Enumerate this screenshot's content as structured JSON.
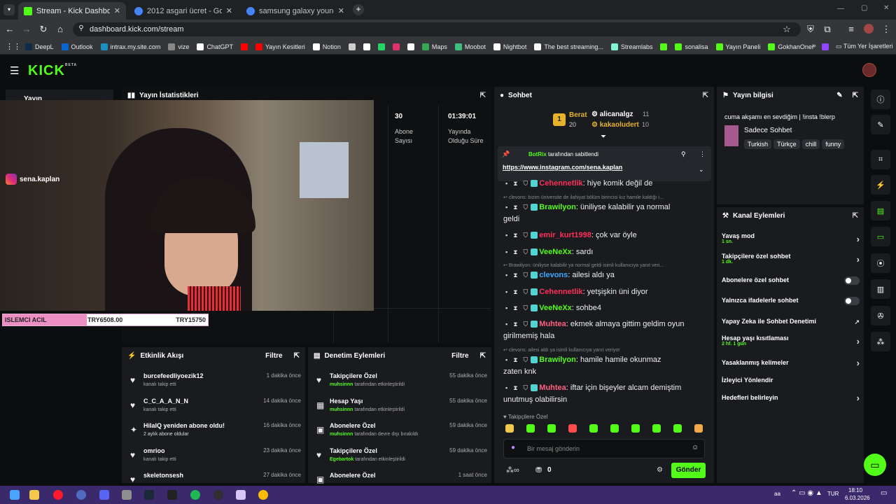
{
  "browser": {
    "tabs": [
      {
        "title": "Stream - Kick Dashboard",
        "color": "#53fc18"
      },
      {
        "title": "2012 asgari ücret - Google'da A",
        "color": "#4285f4"
      },
      {
        "title": "samsung galaxy young - Goog",
        "color": "#4285f4"
      }
    ],
    "url": "dashboard.kick.com/stream",
    "bookmarks": [
      {
        "label": "DeepL",
        "color": "#0f2b46"
      },
      {
        "label": "Outlook",
        "color": "#0a64d2"
      },
      {
        "label": "intrax.my.site.com",
        "color": "#1b8fbf"
      },
      {
        "label": "vize",
        "color": "#888888"
      },
      {
        "label": "ChatGPT",
        "color": "#ffffff"
      },
      {
        "label": "",
        "color": "#ff0000"
      },
      {
        "label": "Yayın Kesitleri",
        "color": "#ff0000"
      },
      {
        "label": "Notion",
        "color": "#ffffff"
      },
      {
        "label": "",
        "color": "#cccccc"
      },
      {
        "label": "",
        "color": "#ffffff"
      },
      {
        "label": "",
        "color": "#25d366"
      },
      {
        "label": "",
        "color": "#e1306c"
      },
      {
        "label": "",
        "color": "#ffffff"
      },
      {
        "label": "Maps",
        "color": "#34a853"
      },
      {
        "label": "Moobot",
        "color": "#3fbf7f"
      },
      {
        "label": "Nightbot",
        "color": "#ffffff"
      },
      {
        "label": "The best streaming...",
        "color": "#ffffff"
      },
      {
        "label": "Streamlabs",
        "color": "#80f5d2"
      },
      {
        "label": "",
        "color": "#53fc18"
      },
      {
        "label": "sonalisa",
        "color": "#53fc18"
      },
      {
        "label": "Yayın Paneli",
        "color": "#53fc18"
      },
      {
        "label": "GokhanOner",
        "color": "#53fc18"
      },
      {
        "label": "",
        "color": "#9146ff"
      }
    ],
    "all_bookmarks": "Tüm Yer İşaretleri"
  },
  "sidebar": {
    "item": "Yayın"
  },
  "stats": {
    "title": "Yayın İstatistikleri",
    "subscribers_value": "30",
    "subscribers_label": "Abone Sayısı",
    "uptime_value": "01:39:01",
    "uptime_label": "Yayında Olduğu Süre"
  },
  "overlay": {
    "instagram": "sena.kaplan",
    "goal_label": "ISLEMCI ACIL",
    "goal_current": "TRY6508.00",
    "goal_target": "TRY15750",
    "goal_progress": 0.413
  },
  "activity": {
    "title": "Etkinlik Akışı",
    "filter": "Filtre",
    "items": [
      {
        "name": "burcefeedliyoezik12",
        "sub": "kanalı takip etti",
        "time": "1 dakika önce",
        "icon": "♥"
      },
      {
        "name": "C_C_A_A_N_N",
        "sub": "kanalı takip etti",
        "time": "14 dakika önce",
        "icon": "♥"
      },
      {
        "name": "HilalQ yeniden abone oldu!",
        "sub": "2 aylık abone oldular",
        "time": "16 dakika önce",
        "icon": "✦"
      },
      {
        "name": "omrioo",
        "sub": "kanalı takip etti",
        "time": "23 dakika önce",
        "icon": "♥"
      },
      {
        "name": "skeletonsesh",
        "sub": "",
        "time": "27 dakika önce",
        "icon": "♥"
      }
    ]
  },
  "moderation": {
    "title": "Denetim Eylemleri",
    "filter": "Filtre",
    "items": [
      {
        "name": "Takipçilere Özel",
        "user": "muhsinnn",
        "sub": "tarafından etkinleştirildi",
        "time": "55 dakika önce",
        "icon": "♥"
      },
      {
        "name": "Hesap Yaşı",
        "user": "muhsinnn",
        "sub": "tarafından etkinleştirildi",
        "time": "55 dakika önce",
        "icon": "▦"
      },
      {
        "name": "Abonelere Özel",
        "user": "muhsinnn",
        "sub": "tarafından devre dışı bırakıldı",
        "time": "59 dakika önce",
        "icon": "▣"
      },
      {
        "name": "Takipçilere Özel",
        "user": "Egebartok",
        "sub": "tarafından etkinleştirildi",
        "time": "59 dakika önce",
        "icon": "♥"
      },
      {
        "name": "Abonelere Özel",
        "user": "",
        "sub": "",
        "time": "1 saat önce",
        "icon": "▣"
      }
    ]
  },
  "chat": {
    "title": "Sohbet",
    "leaders": [
      {
        "rank": "1",
        "name": "Berat",
        "count": "20"
      },
      {
        "name": "alicanalgz",
        "count": "11"
      },
      {
        "name": "kakaoludert",
        "count": "10"
      }
    ],
    "pinned_by": "BotRix",
    "pinned_suffix": "tarafından sabitlendi",
    "pinned_link": "https://www.instagram.com/sena.kaplan",
    "messages": [
      {
        "user": "Cehennetlik",
        "color": "#ff2e5b",
        "text": ": hiye komik değil de"
      },
      {
        "reply": "clevons: bizim üniversite de ilahiyat bölüm birincisi kız hamile kaldığı i..."
      },
      {
        "user": "Brawilyon",
        "color": "#53fc18",
        "text": ": üniliyse kalabilir ya normal"
      },
      {
        "cont": "geldi"
      },
      {
        "user": "emir_kurt1998",
        "color": "#ff2e5b",
        "text": ": çok var öyle"
      },
      {
        "user": "VeeNeXx",
        "color": "#53fc18",
        "text": ": sardı"
      },
      {
        "reply": "Brawilyon: üniliyse kalabilir ya normal geldi isimli kullanıcıya yanıt veri..."
      },
      {
        "user": "clevons",
        "color": "#39a8ff",
        "text": ": ailesi aldı ya"
      },
      {
        "user": "Cehennetlik",
        "color": "#ff2e5b",
        "text": ": yetşişkin üni diyor"
      },
      {
        "user": "VeeNeXx",
        "color": "#53fc18",
        "text": ": sohbe4"
      },
      {
        "user": "Muhtea",
        "color": "#ff5f7f",
        "text": ": ekmek almaya gittim geldim oyun"
      },
      {
        "cont": "girilmemiş hala"
      },
      {
        "reply": "clevons: ailesi aldı ya isimli kullanıcıya yanıt veriyor"
      },
      {
        "user": "Brawilyon",
        "color": "#53fc18",
        "text": ": hamile hamile okunmaz"
      },
      {
        "cont": "zaten knk"
      },
      {
        "user": "Muhtea",
        "color": "#ff5f7f",
        "text": ": iftar için bişeyler alcam demiştim"
      },
      {
        "cont": "unutmuş olabilirsin"
      }
    ],
    "followers_only": "Takipçilere Özel",
    "input_placeholder": "Bir mesaj gönderin",
    "points": "0",
    "send": "Gönder"
  },
  "stream_info": {
    "title": "Yayın bilgisi",
    "stream_title": "cuma akşamı en sevdiğim | !insta !blerp",
    "category": "Sadece Sohbet",
    "tags": [
      "Turkish",
      "Türkçe",
      "chill",
      "funny"
    ]
  },
  "channel_actions": {
    "title": "Kanal Eylemleri",
    "items": [
      {
        "label": "Yavaş mod",
        "sub": "1 sn.",
        "kind": "chev"
      },
      {
        "label": "Takipçilere özel sohbet",
        "sub": "1 dk.",
        "kind": "chev"
      },
      {
        "label": "Abonelere özel sohbet",
        "sub": "",
        "kind": "toggle"
      },
      {
        "label": "Yalnızca ifadelerle sohbet",
        "sub": "",
        "kind": "toggle"
      },
      {
        "label": "Yapay Zeka ile Sohbet Denetimi",
        "sub": "",
        "kind": "ext"
      },
      {
        "label": "Hesap yaşı kısıtlaması",
        "sub": "2 hf. 1 gün",
        "kind": "chev"
      },
      {
        "label": "Yasaklanmış kelimeler",
        "sub": "",
        "kind": "chev"
      },
      {
        "label": "İzleyici Yönlendir",
        "sub": "",
        "kind": "none"
      },
      {
        "label": "Hedefleri belirleyin",
        "sub": "",
        "kind": "chev"
      }
    ]
  },
  "taskbar": {
    "lang": "TUR",
    "time": "18:10",
    "date": "6.03.2026",
    "aa": "aa"
  }
}
